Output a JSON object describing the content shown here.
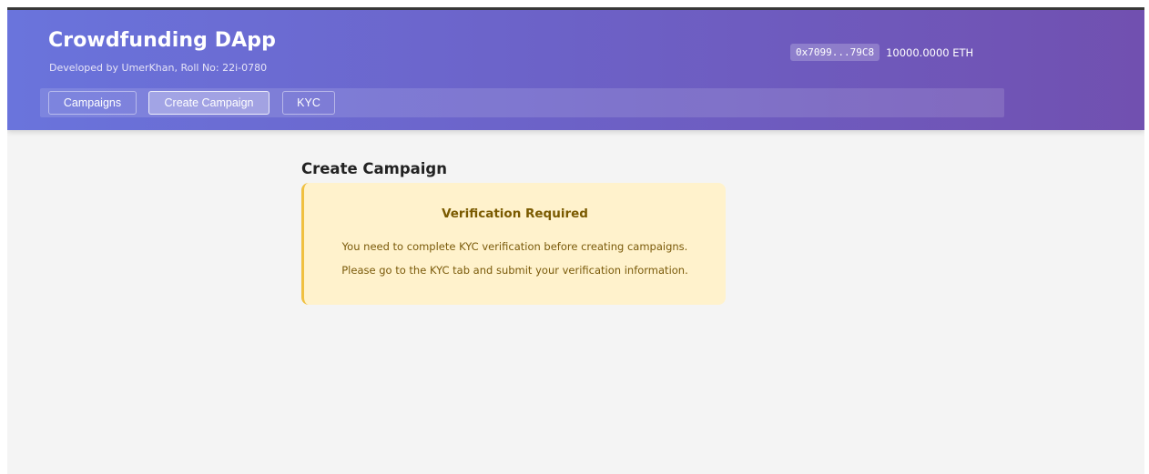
{
  "header": {
    "title": "Crowdfunding DApp",
    "subtitle": "Developed by UmerKhan, Roll No: 22i-0780",
    "wallet": {
      "address": "0x7099...79C8",
      "balance": "10000.0000 ETH"
    }
  },
  "nav": {
    "tabs": [
      {
        "label": "Campaigns",
        "active": false
      },
      {
        "label": "Create Campaign",
        "active": true
      },
      {
        "label": "KYC",
        "active": false
      }
    ]
  },
  "main": {
    "title": "Create Campaign",
    "alert": {
      "title": "Verification Required",
      "lines": [
        "You need to complete KYC verification before creating campaigns.",
        "Please go to the KYC tab and submit your verification information."
      ]
    }
  },
  "colors": {
    "header_gradient_start": "#6a74dc",
    "header_gradient_end": "#7150b0",
    "page_background": "#f4f4f4",
    "alert_background": "#fff2cc",
    "alert_border": "#f0c040",
    "alert_text": "#7a5a00"
  }
}
